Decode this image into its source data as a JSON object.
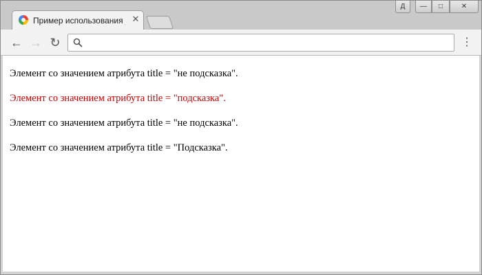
{
  "browser": {
    "tab": {
      "title": "Пример использования jQuery",
      "close_label": "✕"
    },
    "window_controls": {
      "profile_label": "Д",
      "minimize_label": "—",
      "maximize_label": "□",
      "close_label": "✕"
    },
    "toolbar": {
      "back_icon": "←",
      "forward_icon": "→",
      "reload_icon": "↻",
      "menu_icon": "⋮",
      "address_value": "",
      "address_placeholder": ""
    }
  },
  "page": {
    "paragraphs": [
      {
        "text": "Элемент со значением атрибута title = \"не подсказка\".",
        "color": "#000000"
      },
      {
        "text": "Элемент со значением атрибута title = \"подсказка\".",
        "color": "#cc0000"
      },
      {
        "text": "Элемент со значением атрибута title = \"не подсказка\".",
        "color": "#000000"
      },
      {
        "text": "Элемент со значением атрибута title = \"Подсказка\".",
        "color": "#000000"
      }
    ]
  }
}
